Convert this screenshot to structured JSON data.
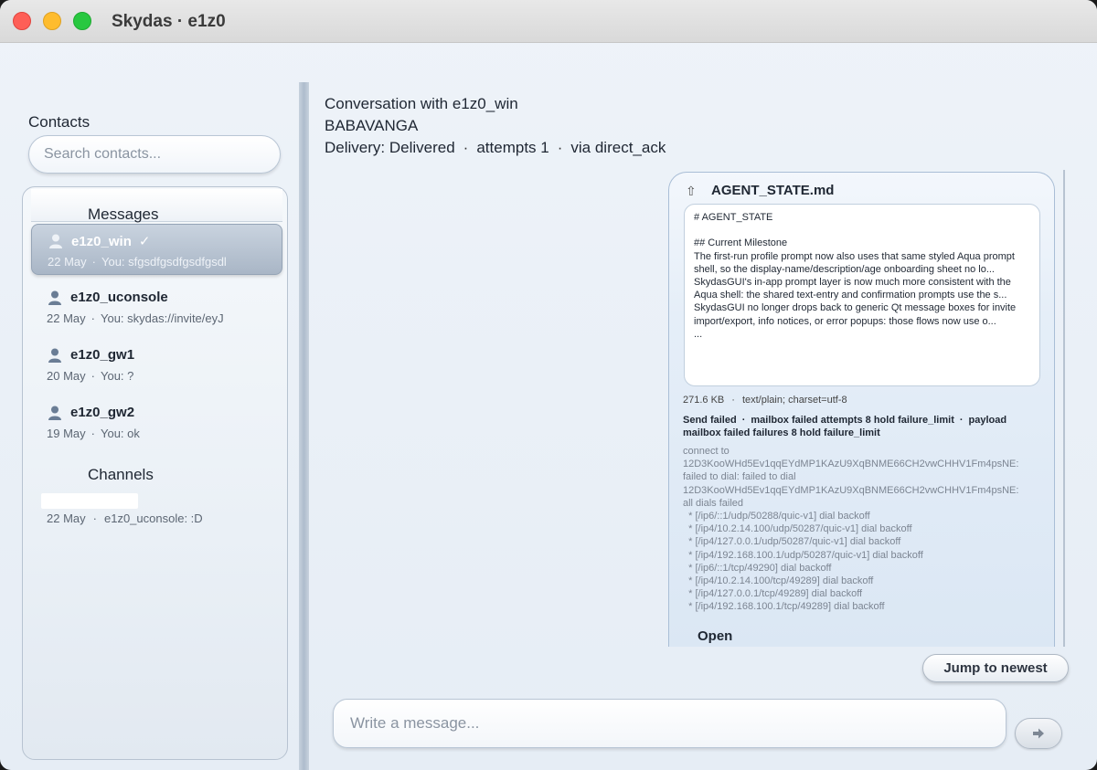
{
  "window": {
    "title": "Skydas · e1z0"
  },
  "sidebar": {
    "contacts_label": "Contacts",
    "search_placeholder": "Search contacts...",
    "messages_header": "Messages",
    "channels_header": "Channels",
    "contacts": [
      {
        "name": "e1z0_win",
        "check": "✓",
        "date": "22 May",
        "preview": "You: sfgsdfgsdfgsdfgsdl",
        "selected": true
      },
      {
        "name": "e1z0_uconsole",
        "date": "22 May",
        "preview": "You: skydas://invite/eyJ"
      },
      {
        "name": "e1z0_gw1",
        "date": "20 May",
        "preview": "You: ?"
      },
      {
        "name": "e1z0_gw2",
        "date": "19 May",
        "preview": "You: ok"
      }
    ],
    "channels": [
      {
        "date": "22 May",
        "preview": "e1z0_uconsole: :D"
      }
    ],
    "separator": "·"
  },
  "conversation": {
    "title": "Conversation with e1z0_win",
    "peer_name": "BABAVANGA",
    "delivery": "Delivery: Delivered",
    "attempts": "attempts 1",
    "via": "via direct_ack",
    "separator": "·"
  },
  "message": {
    "attachment_title": "AGENT_STATE.md",
    "preview_text": "# AGENT_STATE\n\n## Current Milestone\nThe first-run profile prompt now also uses that same styled Aqua prompt shell, so the display-name/description/age onboarding sheet no lo...\nSkydasGUI's in-app prompt layer is now much more consistent with the Aqua shell: the shared text-entry and confirmation prompts use the s...\nSkydasGUI no longer drops back to generic Qt message boxes for invite import/export, info notices, or error popups: those flows now use o...\n...",
    "size": "271.6 KB",
    "mime": "text/plain; charset=utf-8",
    "status_send": "Send failed",
    "status_mailbox": "mailbox failed attempts 8 hold failure_limit",
    "status_payload": "payload mailbox failed failures 8 hold failure_limit",
    "error_log": "connect to\n12D3KooWHd5Ev1qqEYdMP1KAzU9XqBNME66CH2vwCHHV1Fm4psNE:\nfailed to dial: failed to dial\n12D3KooWHd5Ev1qqEYdMP1KAzU9XqBNME66CH2vwCHHV1Fm4psNE:\nall dials failed\n  * [/ip6/::1/udp/50288/quic-v1] dial backoff\n  * [/ip4/10.2.14.100/udp/50287/quic-v1] dial backoff\n  * [/ip4/127.0.0.1/udp/50287/quic-v1] dial backoff\n  * [/ip4/192.168.100.1/udp/50287/quic-v1] dial backoff\n  * [/ip6/::1/tcp/49290] dial backoff\n  * [/ip4/10.2.14.100/tcp/49289] dial backoff\n  * [/ip4/127.0.0.1/tcp/49289] dial backoff\n  * [/ip4/192.168.100.1/tcp/49289] dial backoff",
    "open_label": "Open",
    "separator": "·"
  },
  "controls": {
    "jump_label": "Jump to newest",
    "composer_placeholder": "Write a message...",
    "send_icon": "arrow-right-icon"
  },
  "colors": {
    "selected_row": "#a9b6c6",
    "bubble": "#dbe7f4",
    "traffic_red": "#fe5f57",
    "traffic_yellow": "#febc2e",
    "traffic_green": "#28c840"
  }
}
